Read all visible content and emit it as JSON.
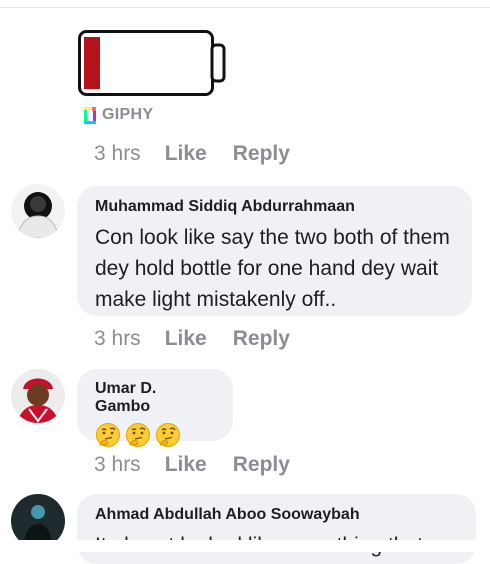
{
  "gif": {
    "provider_label": "GIPHY",
    "battery_fill_level": 0.13,
    "battery_fill_color": "#b5121b"
  },
  "comments": [
    {
      "meta": {
        "time": "3 hrs",
        "like": "Like",
        "reply": "Reply"
      }
    },
    {
      "author": "Muhammad Siddiq Abdurrahmaan",
      "text": "Con look like say the two both of them dey hold bottle for one hand dey wait make light mistakenly off..",
      "meta": {
        "time": "3 hrs",
        "like": "Like",
        "reply": "Reply"
      }
    },
    {
      "author": "Umar D. Gambo",
      "emojis": [
        "thinking-face",
        "thinking-face",
        "thinking-face"
      ],
      "meta": {
        "time": "3 hrs",
        "like": "Like",
        "reply": "Reply"
      }
    },
    {
      "author": "Ahmad Abdullah Aboo Soowaybah",
      "text": "It almost looked like something that"
    }
  ],
  "colors": {
    "bubble": "#eff1f4",
    "meta": "#8a8d91",
    "text": "#1c1e21"
  }
}
